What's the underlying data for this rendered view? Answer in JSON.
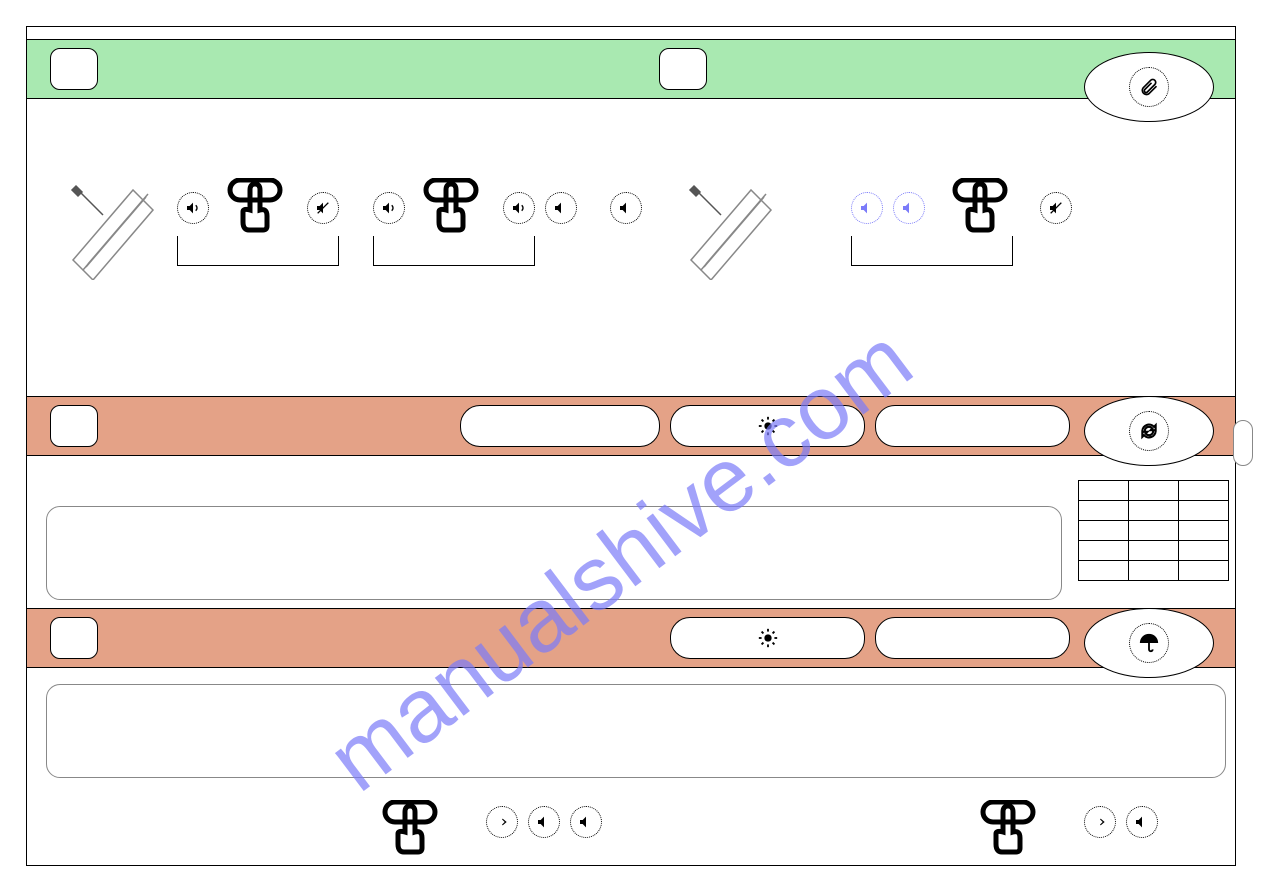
{
  "watermark": "manualshive.com",
  "icons": {
    "paperclip": "paperclip-icon",
    "refresh": "refresh-icon",
    "umbrella": "umbrella-icon",
    "sun": "sun-icon",
    "speaker": "speaker-icon",
    "mute": "mute-icon",
    "press": "press-icon",
    "arrow": "arrow-right-icon",
    "device": "device-icon"
  }
}
